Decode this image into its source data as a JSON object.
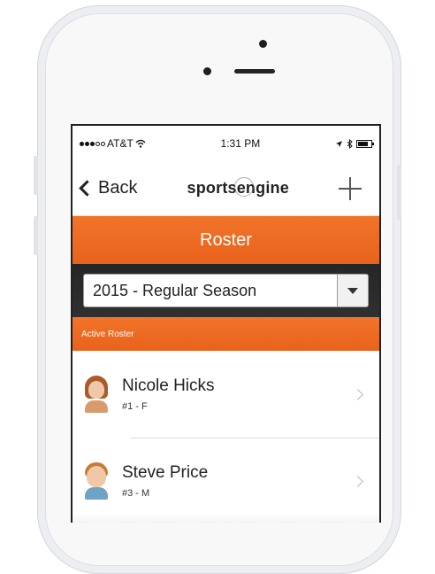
{
  "status_bar": {
    "carrier": "AT&T",
    "time": "1:31 PM"
  },
  "nav": {
    "back_label": "Back",
    "logo_text": "sportsengine"
  },
  "header": {
    "title": "Roster"
  },
  "season_select": {
    "selected": "2015 - Regular Season"
  },
  "roster": {
    "section_label": "Active Roster",
    "players": [
      {
        "name": "Nicole Hicks",
        "meta": "#1 - F"
      },
      {
        "name": "Steve Price",
        "meta": "#3 - M"
      }
    ]
  },
  "colors": {
    "accent": "#ee6b22",
    "dark_bar": "#2a2a2a"
  },
  "icons": {
    "back": "chevron-left-icon",
    "add": "plus-icon",
    "dropdown": "triangle-down-icon",
    "row": "chevron-right-icon",
    "wifi": "wifi-icon",
    "bluetooth": "bluetooth-icon",
    "battery": "battery-icon",
    "location": "location-arrow-icon"
  }
}
